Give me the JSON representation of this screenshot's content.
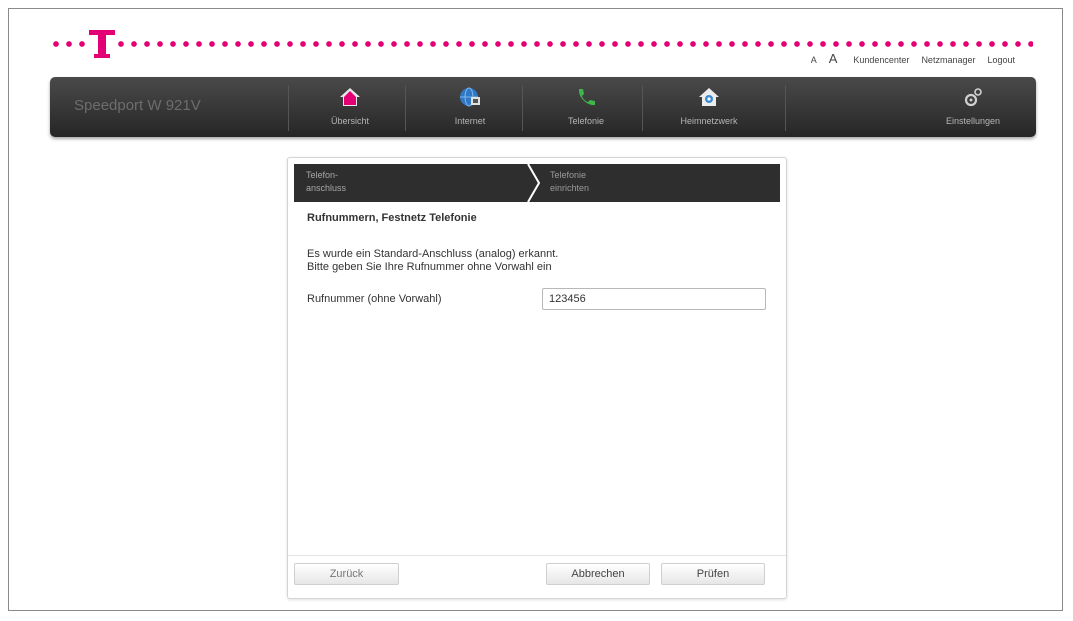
{
  "header": {
    "font_small": "A",
    "font_large": "A",
    "links": [
      "Kundencenter",
      "Netzmanager",
      "Logout"
    ]
  },
  "nav": {
    "device_name": "Speedport W 921V",
    "items": [
      {
        "label": "Übersicht",
        "icon": "home-icon"
      },
      {
        "label": "Internet",
        "icon": "globe-icon"
      },
      {
        "label": "Telefonie",
        "icon": "phone-icon"
      },
      {
        "label": "Heimnetzwerk",
        "icon": "home-network-icon"
      },
      {
        "label": "Einstellungen",
        "icon": "gears-icon"
      }
    ]
  },
  "wizard": {
    "steps": [
      {
        "line1": "Telefon-",
        "line2": "anschluss"
      },
      {
        "line1": "Telefonie",
        "line2": "einrichten"
      }
    ],
    "heading": "Rufnummern, Festnetz Telefonie",
    "info_line1": "Es wurde ein Standard-Anschluss (analog) erkannt.",
    "info_line2": "Bitte geben Sie Ihre Rufnummer ohne Vorwahl ein",
    "field_label": "Rufnummer (ohne Vorwahl)",
    "field_value": "123456",
    "buttons": {
      "back": "Zurück",
      "cancel": "Abbrechen",
      "check": "Prüfen"
    }
  },
  "colors": {
    "brand": "#e20074",
    "nav_bg": "#333333"
  }
}
